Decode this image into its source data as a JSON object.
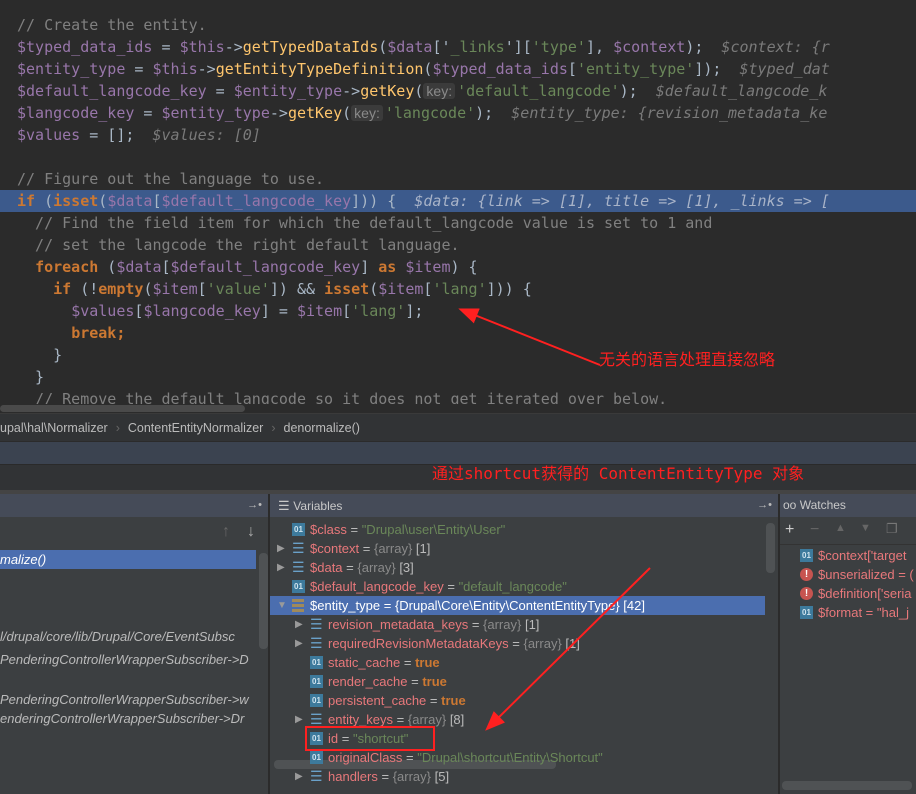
{
  "editor": {
    "highlighted_line": 8,
    "lines": [
      [
        [
          "// Create the entity.",
          "c"
        ]
      ],
      [
        [
          "$typed_data_ids",
          "v"
        ],
        [
          " = ",
          "p"
        ],
        [
          "$this",
          "v"
        ],
        [
          "->",
          "p"
        ],
        [
          "getTypedDataIds",
          "f"
        ],
        [
          "(",
          "p"
        ],
        [
          "$data",
          "v"
        ],
        [
          "['",
          "p"
        ],
        [
          "_links",
          "s"
        ],
        [
          "'][",
          "p"
        ],
        [
          "'type'",
          "s"
        ],
        [
          "], ",
          "p"
        ],
        [
          "$context",
          "v"
        ],
        [
          ");",
          "p"
        ],
        [
          "  $context: {r",
          "h"
        ]
      ],
      [
        [
          "$entity_type",
          "v"
        ],
        [
          " = ",
          "p"
        ],
        [
          "$this",
          "v"
        ],
        [
          "->",
          "p"
        ],
        [
          "getEntityTypeDefinition",
          "f"
        ],
        [
          "(",
          "p"
        ],
        [
          "$typed_data_ids",
          "v"
        ],
        [
          "[",
          "p"
        ],
        [
          "'entity_type'",
          "s"
        ],
        [
          "]);",
          "p"
        ],
        [
          "  $typed_dat",
          "h"
        ]
      ],
      [
        [
          "$default_langcode_key",
          "v"
        ],
        [
          " = ",
          "p"
        ],
        [
          "$entity_type",
          "v"
        ],
        [
          "->",
          "p"
        ],
        [
          "getKey",
          "f"
        ],
        [
          "(",
          "p"
        ],
        [
          "key:",
          "kl"
        ],
        [
          "'default_langcode'",
          "s"
        ],
        [
          ");",
          "p"
        ],
        [
          "  $default_langcode_k",
          "h"
        ]
      ],
      [
        [
          "$langcode_key",
          "v"
        ],
        [
          " = ",
          "p"
        ],
        [
          "$entity_type",
          "v"
        ],
        [
          "->",
          "p"
        ],
        [
          "getKey",
          "f"
        ],
        [
          "(",
          "p"
        ],
        [
          "key:",
          "kl"
        ],
        [
          "'langcode'",
          "s"
        ],
        [
          ");",
          "p"
        ],
        [
          "  $entity_type: {revision_metadata_ke",
          "h"
        ]
      ],
      [
        [
          "$values",
          "v"
        ],
        [
          " = [];",
          "p"
        ],
        [
          "  $values: [0]",
          "h"
        ]
      ],
      [],
      [
        [
          "// Figure out the language to use.",
          "c"
        ]
      ],
      [
        [
          "if",
          "k"
        ],
        [
          " (",
          "p"
        ],
        [
          "isset",
          "k"
        ],
        [
          "(",
          "p"
        ],
        [
          "$data",
          "v"
        ],
        [
          "[",
          "p"
        ],
        [
          "$default_langcode_key",
          "v"
        ],
        [
          "])) {",
          "p"
        ],
        [
          "  $data: {link => [1], title => [1], _links => [",
          "h"
        ]
      ],
      [
        [
          "  // Find the field item for which the default_langcode value is set to 1 and",
          "c"
        ]
      ],
      [
        [
          "  // set the langcode the right default language.",
          "c"
        ]
      ],
      [
        [
          "  ",
          "p"
        ],
        [
          "foreach",
          "k"
        ],
        [
          " (",
          "p"
        ],
        [
          "$data",
          "v"
        ],
        [
          "[",
          "p"
        ],
        [
          "$default_langcode_key",
          "v"
        ],
        [
          "] ",
          "p"
        ],
        [
          "as",
          "k"
        ],
        [
          " ",
          "p"
        ],
        [
          "$item",
          "v"
        ],
        [
          ") {",
          "p"
        ]
      ],
      [
        [
          "    ",
          "p"
        ],
        [
          "if",
          "k"
        ],
        [
          " (!",
          "p"
        ],
        [
          "empty",
          "k"
        ],
        [
          "(",
          "p"
        ],
        [
          "$item",
          "v"
        ],
        [
          "[",
          "p"
        ],
        [
          "'value'",
          "s"
        ],
        [
          "]) && ",
          "p"
        ],
        [
          "isset",
          "k"
        ],
        [
          "(",
          "p"
        ],
        [
          "$item",
          "v"
        ],
        [
          "[",
          "p"
        ],
        [
          "'lang'",
          "s"
        ],
        [
          "])) {",
          "p"
        ]
      ],
      [
        [
          "      ",
          "p"
        ],
        [
          "$values",
          "v"
        ],
        [
          "[",
          "p"
        ],
        [
          "$langcode_key",
          "v"
        ],
        [
          "] = ",
          "p"
        ],
        [
          "$item",
          "v"
        ],
        [
          "[",
          "p"
        ],
        [
          "'lang'",
          "s"
        ],
        [
          "];",
          "p"
        ]
      ],
      [
        [
          "      ",
          "p"
        ],
        [
          "break",
          "k"
        ],
        [
          ";",
          "k"
        ]
      ],
      [
        [
          "    }",
          "p"
        ]
      ],
      [
        [
          "  }",
          "p"
        ]
      ],
      [
        [
          "  // Remove the default langcode so it does not get iterated over below.",
          "c"
        ]
      ]
    ]
  },
  "breadcrumb": [
    "upal\\hal\\Normalizer",
    "ContentEntityNormalizer",
    "denormalize()"
  ],
  "annotations": {
    "lang_note": "无关的语言处理直接忽略",
    "shortcut_note": "通过shortcut获得的 ContentEntityType 对象",
    "color": "#ff2020"
  },
  "panels": {
    "variables_title": "Variables",
    "watches_title": "Watches"
  },
  "frames": [
    {
      "text": "malize()",
      "selected": true
    },
    {
      "text": "l/drupal/core/lib/Drupal/Core/EventSubsc",
      "selected": false
    },
    {
      "text": "PenderingControllerWrapperSubscriber->D",
      "selected": false
    },
    {
      "text": "PenderingControllerWrapperSubscriber->w",
      "selected": false
    },
    {
      "text": "enderingControllerWrapperSubscriber->Dr",
      "selected": false
    }
  ],
  "variables": [
    {
      "level": 0,
      "icon": "value",
      "name": "$class",
      "value": "\"Drupal\\user\\Entity\\User\"",
      "vtype": "s"
    },
    {
      "level": 0,
      "icon": "array",
      "expand": "collapsed",
      "name": "$context",
      "value": "{array}",
      "count": "[1]"
    },
    {
      "level": 0,
      "icon": "array",
      "expand": "collapsed",
      "name": "$data",
      "value": "{array}",
      "count": "[3]"
    },
    {
      "level": 0,
      "icon": "value",
      "name": "$default_langcode_key",
      "value": "\"default_langcode\"",
      "vtype": "s"
    },
    {
      "level": 0,
      "icon": "object",
      "expand": "expanded",
      "name": "$entity_type",
      "value": "{Drupal\\Core\\Entity\\ContentEntityType}",
      "count": "[42]",
      "selected": true
    },
    {
      "level": 1,
      "icon": "array",
      "expand": "collapsed",
      "name": "revision_metadata_keys",
      "value": "{array}",
      "count": "[1]"
    },
    {
      "level": 1,
      "icon": "array",
      "expand": "collapsed",
      "name": "requiredRevisionMetadataKeys",
      "value": "{array}",
      "count": "[1]"
    },
    {
      "level": 1,
      "icon": "value",
      "name": "static_cache",
      "value": "true",
      "vtype": "b"
    },
    {
      "level": 1,
      "icon": "value",
      "name": "render_cache",
      "value": "true",
      "vtype": "b"
    },
    {
      "level": 1,
      "icon": "value",
      "name": "persistent_cache",
      "value": "true",
      "vtype": "b"
    },
    {
      "level": 1,
      "icon": "array",
      "expand": "collapsed",
      "name": "entity_keys",
      "value": "{array}",
      "count": "[8]"
    },
    {
      "level": 1,
      "icon": "value",
      "name": "id",
      "value": "\"shortcut\"",
      "vtype": "s"
    },
    {
      "level": 1,
      "icon": "value",
      "name": "originalClass",
      "value": "\"Drupal\\shortcut\\Entity\\Shortcut\"",
      "vtype": "s"
    },
    {
      "level": 1,
      "icon": "array",
      "expand": "collapsed",
      "name": "handlers",
      "value": "{array}",
      "count": "[5]"
    }
  ],
  "watches": [
    {
      "icon": "value",
      "text": "$context['target"
    },
    {
      "icon": "error",
      "text": "$unserialized = ("
    },
    {
      "icon": "error",
      "text": "$definition['seria"
    },
    {
      "icon": "value",
      "text": "$format = \"hal_j"
    }
  ]
}
